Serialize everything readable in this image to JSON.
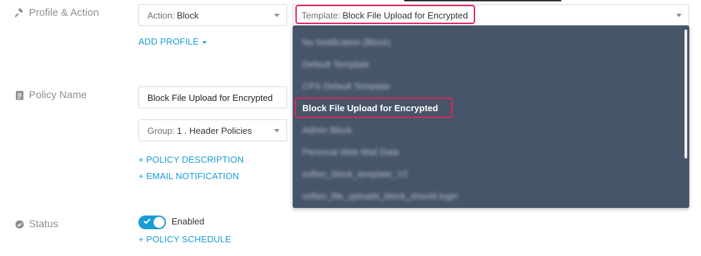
{
  "profile_action": {
    "label": "Profile & Action",
    "action_prefix": "Action:",
    "action_value": "Block",
    "template_prefix": "Template:",
    "template_value": "Block File Upload for Encrypted",
    "add_profile": "ADD PROFILE"
  },
  "template_dropdown": {
    "items": [
      {
        "label": "No Notification (Block)",
        "blurred": true
      },
      {
        "label": "Default Template",
        "blurred": true
      },
      {
        "label": "CPS Default Template",
        "blurred": true
      },
      {
        "label": "Block File Upload for Encrypted",
        "blurred": false,
        "selected": true
      },
      {
        "label": "Admin Block",
        "blurred": true
      },
      {
        "label": "Personal Web Mail Data",
        "blurred": true
      },
      {
        "label": "soften_block_template_V2",
        "blurred": true
      },
      {
        "label": "soften_file_uploads_block_should.login",
        "blurred": true
      }
    ]
  },
  "policy_name": {
    "label": "Policy Name",
    "value": "Block File Upload for Encrypted",
    "group_prefix": "Group:",
    "group_value": "1 . Header Policies",
    "policy_description": "+ POLICY DESCRIPTION",
    "email_notification": "+ EMAIL NOTIFICATION"
  },
  "status": {
    "label": "Status",
    "toggle_label": "Enabled",
    "enabled": true,
    "policy_schedule": "+ POLICY SCHEDULE"
  },
  "colors": {
    "accent": "#1a9bd7",
    "highlight": "#e0245e",
    "dropdown_bg": "#475569"
  }
}
